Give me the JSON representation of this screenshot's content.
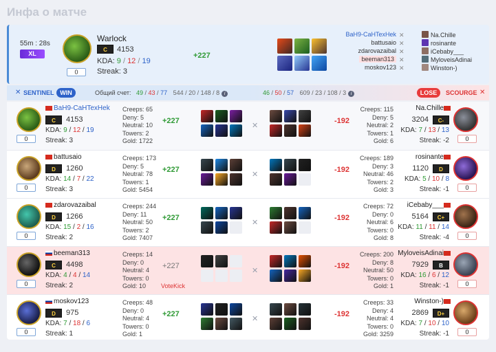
{
  "page_title": "Инфа о матче",
  "summary": {
    "time": "55m : 28s",
    "mode": "XL",
    "hero": "Warlock",
    "rank": "C",
    "mmr": "4153",
    "kda_label": "KDA:",
    "kda_k": "9",
    "kda_d": "12",
    "kda_a": "19",
    "streak": "Streak: 3",
    "level": "0",
    "delta": "+227",
    "players": [
      {
        "left": "BaH9-CaHTexHek",
        "right": "Na.Chille"
      },
      {
        "left": "battusaio",
        "right": "rosinante"
      },
      {
        "left": "zdarovazaibal",
        "right": "iCebaby___"
      },
      {
        "left": "beeman313",
        "right": "MyloveisAdinai"
      },
      {
        "left": "moskov123",
        "right": "Winston-)"
      }
    ]
  },
  "bar": {
    "sentinel": "SENTINEL",
    "win": "WIN",
    "score_label": "Общий счет:",
    "s1": "49",
    "s2": "43",
    "s3": "77",
    "s_rest": "544 / 20 / 148 / 8",
    "r1": "46",
    "r2": "50",
    "r3": "57",
    "r_rest": "609 / 23 / 108 / 3",
    "lose": "LOSE",
    "scourge": "SCOURGE"
  },
  "rows": [
    {
      "name": "BaH9-CaHTexHek",
      "rank": "C",
      "mmr": "4153",
      "k": "9",
      "d": "12",
      "a": "19",
      "streak": "Streak: 3",
      "lvl": "0",
      "stats": [
        "Creeps: 65",
        "Deny: 5",
        "Neutral: 10",
        "Towers: 2",
        "Gold: 1722"
      ],
      "delta": "+227",
      "rdelta": "-192",
      "rstats": [
        "Creeps: 115",
        "Deny: 5",
        "Neutral: 2",
        "Towers: 1",
        "Gold: 6"
      ],
      "rname": "Na.Chille",
      "rmmr": "3204",
      "rrank": "C-",
      "rk": "7",
      "rd": "13",
      "ra": "13",
      "rstreak": "Streak: -2",
      "rlvl": "0"
    },
    {
      "name": "battusaio",
      "rank": "D",
      "mmr": "1260",
      "k": "14",
      "d": "7",
      "a": "22",
      "streak": "Streak: 3",
      "lvl": "0",
      "stats": [
        "Creeps: 173",
        "Deny: 5",
        "Neutral: 78",
        "Towers: 1",
        "Gold: 5454"
      ],
      "delta": "+227",
      "rdelta": "-192",
      "rstats": [
        "Creeps: 189",
        "Deny: 3",
        "Neutral: 46",
        "Towers: 2",
        "Gold: 3"
      ],
      "rname": "rosinante",
      "rmmr": "1120",
      "rrank": "D",
      "rk": "5",
      "rd": "10",
      "ra": "8",
      "rstreak": "Streak: -1",
      "rlvl": "0"
    },
    {
      "name": "zdarovazaibal",
      "rank": "D",
      "mmr": "1266",
      "k": "15",
      "d": "2",
      "a": "16",
      "streak": "Streak: 2",
      "lvl": "0",
      "stats": [
        "Creeps: 244",
        "Deny: 11",
        "Neutral: 50",
        "Towers: 2",
        "Gold: 7407"
      ],
      "delta": "+227",
      "rdelta": "-192",
      "rstats": [
        "Creeps: 72",
        "Deny: 0",
        "Neutral: 6",
        "Towers: 0",
        "Gold: 8"
      ],
      "rname": "iCebaby___",
      "rmmr": "5164",
      "rrank": "C+",
      "rk": "11",
      "rd": "11",
      "ra": "14",
      "rstreak": "Streak: -4",
      "rlvl": "0"
    },
    {
      "name": "beeman313",
      "rank": "C",
      "mmr": "4498",
      "k": "4",
      "d": "4",
      "a": "14",
      "streak": "Streak: 2",
      "lvl": "0",
      "stats": [
        "Creeps: 14",
        "Deny: 0",
        "Neutral: 4",
        "Towers: 0",
        "Gold: 10"
      ],
      "delta": "+227",
      "votekick": "VoteKick",
      "rdelta": "-192",
      "rstats": [
        "Creeps: 200",
        "Deny: 8",
        "Neutral: 50",
        "Towers: 0",
        "Gold: 1"
      ],
      "rname": "MyloveisAdinai",
      "rmmr": "7929",
      "rrank": "B",
      "rk": "16",
      "rd": "6",
      "ra": "12",
      "rstreak": "Streak: -1",
      "rlvl": "0"
    },
    {
      "name": "moskov123",
      "rank": "D",
      "mmr": "975",
      "k": "7",
      "d": "18",
      "a": "6",
      "streak": "Streak: 1",
      "lvl": "0",
      "stats": [
        "Creeps: 48",
        "Deny: 0",
        "Neutral: 4",
        "Towers: 0",
        "Gold: 1"
      ],
      "delta": "+227",
      "rdelta": "-192",
      "rstats": [
        "Creeps: 33",
        "Deny: 4",
        "Neutral: 4",
        "Towers: 0",
        "Gold: 3259"
      ],
      "rname": "Winston-)",
      "rmmr": "2869",
      "rrank": "D+",
      "rk": "7",
      "rd": "10",
      "ra": "10",
      "rstreak": "Streak: -1",
      "rlvl": "0"
    }
  ]
}
